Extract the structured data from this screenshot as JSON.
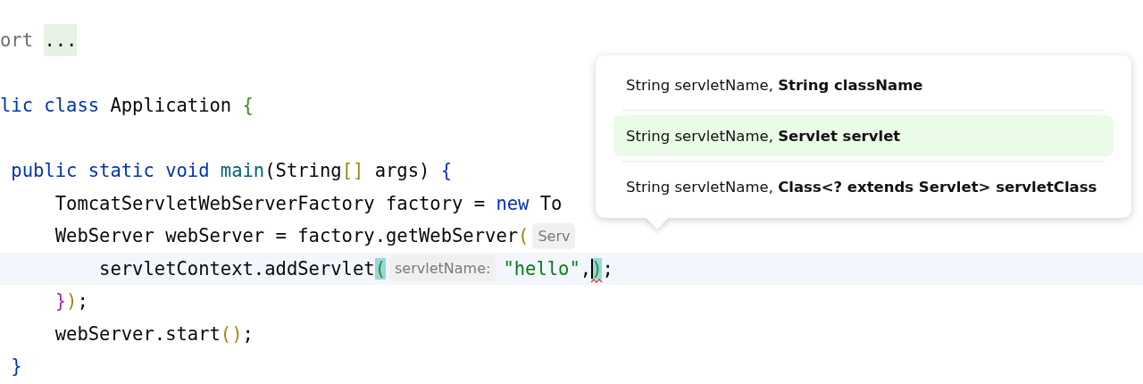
{
  "editor": {
    "lines": [
      {
        "current": false,
        "tokens": [
          {
            "kind": "code",
            "text": "ort ",
            "color": "#6e6e6e"
          },
          {
            "kind": "fold",
            "text": "..."
          }
        ]
      },
      {
        "current": false
      },
      {
        "current": false,
        "tokens": [
          {
            "kind": "code",
            "text": "lic class ",
            "color": "#0033b3"
          },
          {
            "kind": "code",
            "text": "Application ",
            "color": "#080808"
          },
          {
            "kind": "code",
            "text": "{",
            "color": "#3c8a1c"
          }
        ]
      },
      {
        "current": false
      },
      {
        "current": false,
        "tokens": [
          {
            "kind": "code",
            "text": " public static void ",
            "color": "#0033b3"
          },
          {
            "kind": "code",
            "text": "main",
            "color": "#00627a"
          },
          {
            "kind": "code",
            "text": "(String",
            "color": "#080808"
          },
          {
            "kind": "code",
            "text": "[]",
            "color": "#9e880d"
          },
          {
            "kind": "code",
            "text": " args) ",
            "color": "#080808"
          },
          {
            "kind": "code",
            "text": "{",
            "color": "#0033b3"
          }
        ]
      },
      {
        "current": false,
        "tokens": [
          {
            "kind": "code",
            "text": "     TomcatServletWebServerFactory factory = ",
            "color": "#080808"
          },
          {
            "kind": "code",
            "text": "new ",
            "color": "#0033b3"
          },
          {
            "kind": "code",
            "text": "To",
            "color": "#080808"
          }
        ]
      },
      {
        "current": false,
        "tokens": [
          {
            "kind": "code",
            "text": "     WebServer webServer = factory.getWebServer",
            "color": "#080808"
          },
          {
            "kind": "code",
            "text": "(",
            "color": "#9e880d"
          },
          {
            "kind": "hint",
            "text": "Serv"
          }
        ]
      },
      {
        "current": true,
        "tokens": [
          {
            "kind": "code",
            "text": "         servletContext.addServlet",
            "color": "#080808"
          },
          {
            "kind": "match",
            "text": "(",
            "color": "#93d9d9"
          },
          {
            "kind": "hint",
            "text": "servletName:"
          },
          {
            "kind": "code",
            "text": "\"hello\"",
            "color": "#067d17"
          },
          {
            "kind": "code",
            "text": ",",
            "color": "#080808"
          },
          {
            "kind": "match",
            "text": ")",
            "color": "#93d9d9",
            "caret": true,
            "error": true
          },
          {
            "kind": "code",
            "text": ";",
            "color": "#080808"
          }
        ]
      },
      {
        "current": false,
        "tokens": [
          {
            "kind": "code",
            "text": "     }",
            "color": "#a626a4"
          },
          {
            "kind": "code",
            "text": ")",
            "color": "#9e880d"
          },
          {
            "kind": "code",
            "text": ";",
            "color": "#080808"
          }
        ]
      },
      {
        "current": false,
        "tokens": [
          {
            "kind": "code",
            "text": "     webServer.start",
            "color": "#080808"
          },
          {
            "kind": "code",
            "text": "()",
            "color": "#9e880d"
          },
          {
            "kind": "code",
            "text": ";",
            "color": "#080808"
          }
        ]
      },
      {
        "current": false,
        "tokens": [
          {
            "kind": "code",
            "text": " }",
            "color": "#0033b3"
          }
        ]
      }
    ]
  },
  "popup": {
    "items": [
      {
        "text": "String servletName, **String className**",
        "selected": false
      },
      {
        "text": "String servletName, **Servlet servlet**",
        "selected": true
      },
      {
        "text": "String servletName, **Class<? extends Servlet> servletClass**",
        "selected": false
      }
    ]
  }
}
